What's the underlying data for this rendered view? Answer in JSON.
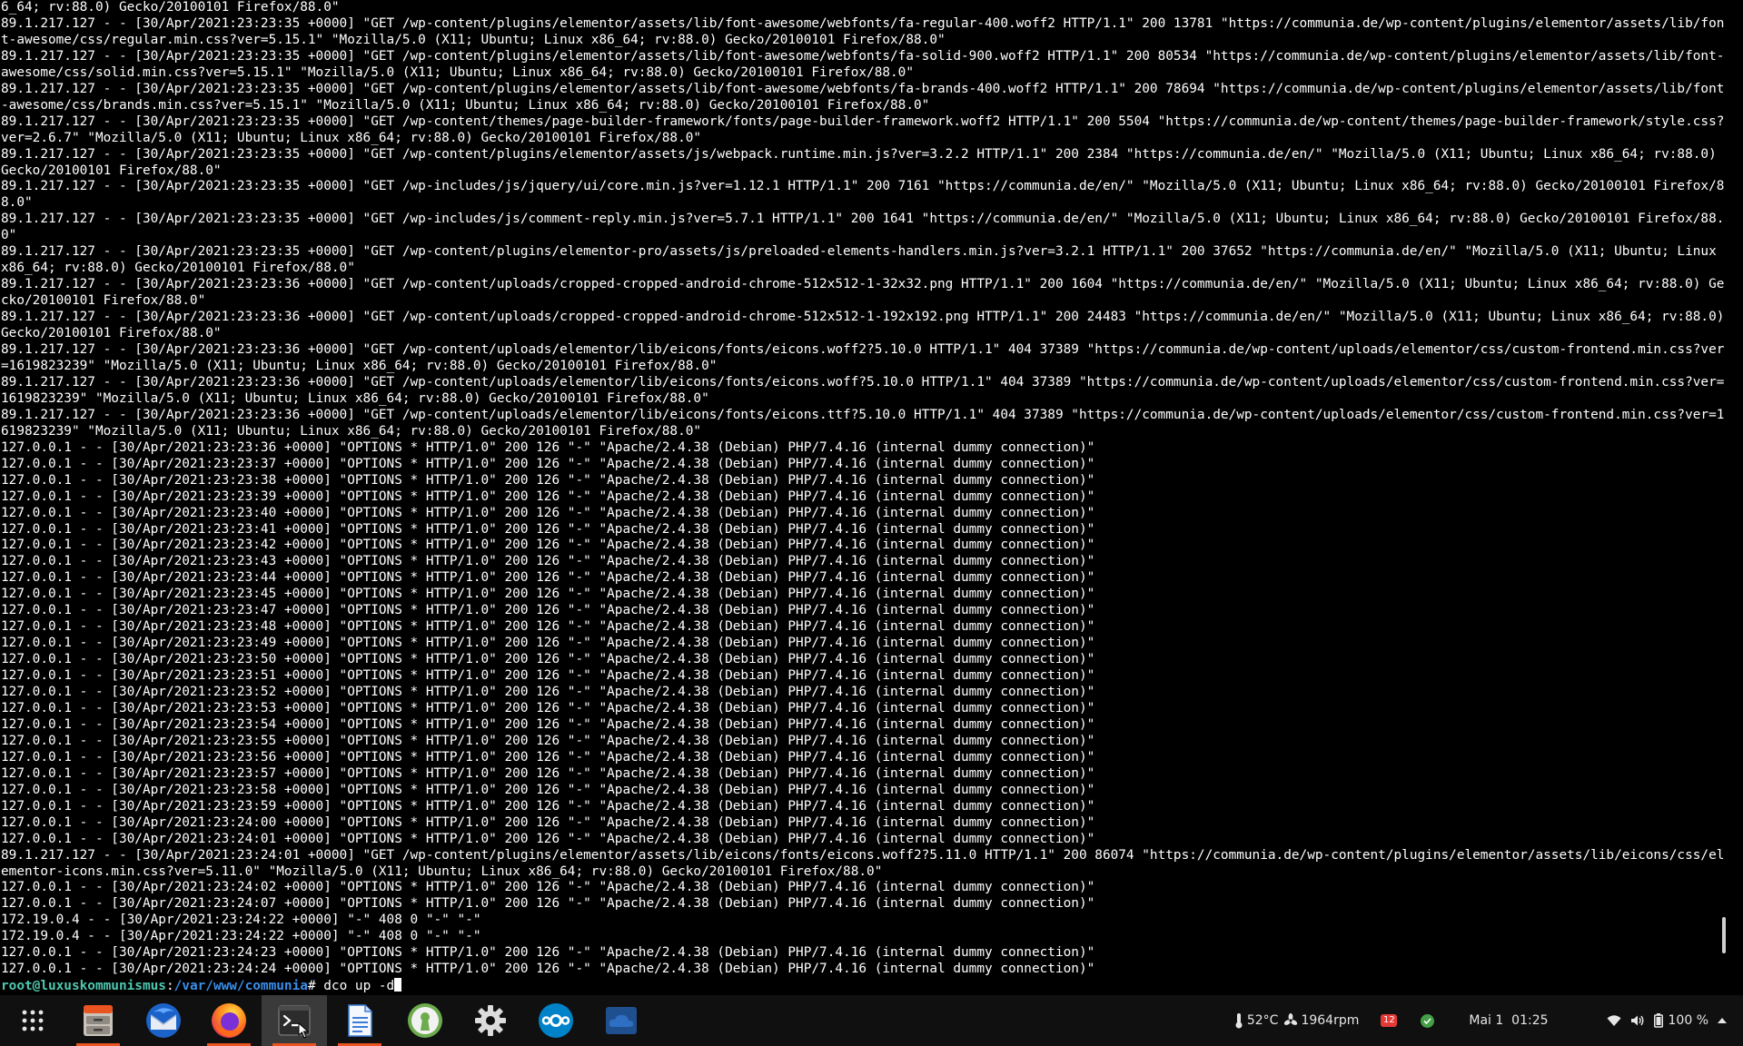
{
  "terminal": {
    "log_lines": [
      "6_64; rv:88.0) Gecko/20100101 Firefox/88.0\"",
      "89.1.217.127 - - [30/Apr/2021:23:23:35 +0000] \"GET /wp-content/plugins/elementor/assets/lib/font-awesome/webfonts/fa-regular-400.woff2 HTTP/1.1\" 200 13781 \"https://communia.de/wp-content/plugins/elementor/assets/lib/font-awesome/css/regular.min.css?ver=5.15.1\" \"Mozilla/5.0 (X11; Ubuntu; Linux x86_64; rv:88.0) Gecko/20100101 Firefox/88.0\"",
      "89.1.217.127 - - [30/Apr/2021:23:23:35 +0000] \"GET /wp-content/plugins/elementor/assets/lib/font-awesome/webfonts/fa-solid-900.woff2 HTTP/1.1\" 200 80534 \"https://communia.de/wp-content/plugins/elementor/assets/lib/font-awesome/css/solid.min.css?ver=5.15.1\" \"Mozilla/5.0 (X11; Ubuntu; Linux x86_64; rv:88.0) Gecko/20100101 Firefox/88.0\"",
      "89.1.217.127 - - [30/Apr/2021:23:23:35 +0000] \"GET /wp-content/plugins/elementor/assets/lib/font-awesome/webfonts/fa-brands-400.woff2 HTTP/1.1\" 200 78694 \"https://communia.de/wp-content/plugins/elementor/assets/lib/font-awesome/css/brands.min.css?ver=5.15.1\" \"Mozilla/5.0 (X11; Ubuntu; Linux x86_64; rv:88.0) Gecko/20100101 Firefox/88.0\"",
      "89.1.217.127 - - [30/Apr/2021:23:23:35 +0000] \"GET /wp-content/themes/page-builder-framework/fonts/page-builder-framework.woff2 HTTP/1.1\" 200 5504 \"https://communia.de/wp-content/themes/page-builder-framework/style.css?ver=2.6.7\" \"Mozilla/5.0 (X11; Ubuntu; Linux x86_64; rv:88.0) Gecko/20100101 Firefox/88.0\"",
      "89.1.217.127 - - [30/Apr/2021:23:23:35 +0000] \"GET /wp-content/plugins/elementor/assets/js/webpack.runtime.min.js?ver=3.2.2 HTTP/1.1\" 200 2384 \"https://communia.de/en/\" \"Mozilla/5.0 (X11; Ubuntu; Linux x86_64; rv:88.0) Gecko/20100101 Firefox/88.0\"",
      "89.1.217.127 - - [30/Apr/2021:23:23:35 +0000] \"GET /wp-includes/js/jquery/ui/core.min.js?ver=1.12.1 HTTP/1.1\" 200 7161 \"https://communia.de/en/\" \"Mozilla/5.0 (X11; Ubuntu; Linux x86_64; rv:88.0) Gecko/20100101 Firefox/88.0\"",
      "89.1.217.127 - - [30/Apr/2021:23:23:35 +0000] \"GET /wp-includes/js/comment-reply.min.js?ver=5.7.1 HTTP/1.1\" 200 1641 \"https://communia.de/en/\" \"Mozilla/5.0 (X11; Ubuntu; Linux x86_64; rv:88.0) Gecko/20100101 Firefox/88.0\"",
      "89.1.217.127 - - [30/Apr/2021:23:23:35 +0000] \"GET /wp-content/plugins/elementor-pro/assets/js/preloaded-elements-handlers.min.js?ver=3.2.1 HTTP/1.1\" 200 37652 \"https://communia.de/en/\" \"Mozilla/5.0 (X11; Ubuntu; Linux x86_64; rv:88.0) Gecko/20100101 Firefox/88.0\"",
      "89.1.217.127 - - [30/Apr/2021:23:23:36 +0000] \"GET /wp-content/uploads/cropped-cropped-android-chrome-512x512-1-32x32.png HTTP/1.1\" 200 1604 \"https://communia.de/en/\" \"Mozilla/5.0 (X11; Ubuntu; Linux x86_64; rv:88.0) Gecko/20100101 Firefox/88.0\"",
      "89.1.217.127 - - [30/Apr/2021:23:23:36 +0000] \"GET /wp-content/uploads/cropped-cropped-android-chrome-512x512-1-192x192.png HTTP/1.1\" 200 24483 \"https://communia.de/en/\" \"Mozilla/5.0 (X11; Ubuntu; Linux x86_64; rv:88.0) Gecko/20100101 Firefox/88.0\"",
      "89.1.217.127 - - [30/Apr/2021:23:23:36 +0000] \"GET /wp-content/uploads/elementor/lib/eicons/fonts/eicons.woff2?5.10.0 HTTP/1.1\" 404 37389 \"https://communia.de/wp-content/uploads/elementor/css/custom-frontend.min.css?ver=1619823239\" \"Mozilla/5.0 (X11; Ubuntu; Linux x86_64; rv:88.0) Gecko/20100101 Firefox/88.0\"",
      "89.1.217.127 - - [30/Apr/2021:23:23:36 +0000] \"GET /wp-content/uploads/elementor/lib/eicons/fonts/eicons.woff?5.10.0 HTTP/1.1\" 404 37389 \"https://communia.de/wp-content/uploads/elementor/css/custom-frontend.min.css?ver=1619823239\" \"Mozilla/5.0 (X11; Ubuntu; Linux x86_64; rv:88.0) Gecko/20100101 Firefox/88.0\"",
      "89.1.217.127 - - [30/Apr/2021:23:23:36 +0000] \"GET /wp-content/uploads/elementor/lib/eicons/fonts/eicons.ttf?5.10.0 HTTP/1.1\" 404 37389 \"https://communia.de/wp-content/uploads/elementor/css/custom-frontend.min.css?ver=1619823239\" \"Mozilla/5.0 (X11; Ubuntu; Linux x86_64; rv:88.0) Gecko/20100101 Firefox/88.0\"",
      "127.0.0.1 - - [30/Apr/2021:23:23:36 +0000] \"OPTIONS * HTTP/1.0\" 200 126 \"-\" \"Apache/2.4.38 (Debian) PHP/7.4.16 (internal dummy connection)\"",
      "127.0.0.1 - - [30/Apr/2021:23:23:37 +0000] \"OPTIONS * HTTP/1.0\" 200 126 \"-\" \"Apache/2.4.38 (Debian) PHP/7.4.16 (internal dummy connection)\"",
      "127.0.0.1 - - [30/Apr/2021:23:23:38 +0000] \"OPTIONS * HTTP/1.0\" 200 126 \"-\" \"Apache/2.4.38 (Debian) PHP/7.4.16 (internal dummy connection)\"",
      "127.0.0.1 - - [30/Apr/2021:23:23:39 +0000] \"OPTIONS * HTTP/1.0\" 200 126 \"-\" \"Apache/2.4.38 (Debian) PHP/7.4.16 (internal dummy connection)\"",
      "127.0.0.1 - - [30/Apr/2021:23:23:40 +0000] \"OPTIONS * HTTP/1.0\" 200 126 \"-\" \"Apache/2.4.38 (Debian) PHP/7.4.16 (internal dummy connection)\"",
      "127.0.0.1 - - [30/Apr/2021:23:23:41 +0000] \"OPTIONS * HTTP/1.0\" 200 126 \"-\" \"Apache/2.4.38 (Debian) PHP/7.4.16 (internal dummy connection)\"",
      "127.0.0.1 - - [30/Apr/2021:23:23:42 +0000] \"OPTIONS * HTTP/1.0\" 200 126 \"-\" \"Apache/2.4.38 (Debian) PHP/7.4.16 (internal dummy connection)\"",
      "127.0.0.1 - - [30/Apr/2021:23:23:43 +0000] \"OPTIONS * HTTP/1.0\" 200 126 \"-\" \"Apache/2.4.38 (Debian) PHP/7.4.16 (internal dummy connection)\"",
      "127.0.0.1 - - [30/Apr/2021:23:23:44 +0000] \"OPTIONS * HTTP/1.0\" 200 126 \"-\" \"Apache/2.4.38 (Debian) PHP/7.4.16 (internal dummy connection)\"",
      "127.0.0.1 - - [30/Apr/2021:23:23:45 +0000] \"OPTIONS * HTTP/1.0\" 200 126 \"-\" \"Apache/2.4.38 (Debian) PHP/7.4.16 (internal dummy connection)\"",
      "127.0.0.1 - - [30/Apr/2021:23:23:47 +0000] \"OPTIONS * HTTP/1.0\" 200 126 \"-\" \"Apache/2.4.38 (Debian) PHP/7.4.16 (internal dummy connection)\"",
      "127.0.0.1 - - [30/Apr/2021:23:23:48 +0000] \"OPTIONS * HTTP/1.0\" 200 126 \"-\" \"Apache/2.4.38 (Debian) PHP/7.4.16 (internal dummy connection)\"",
      "127.0.0.1 - - [30/Apr/2021:23:23:49 +0000] \"OPTIONS * HTTP/1.0\" 200 126 \"-\" \"Apache/2.4.38 (Debian) PHP/7.4.16 (internal dummy connection)\"",
      "127.0.0.1 - - [30/Apr/2021:23:23:50 +0000] \"OPTIONS * HTTP/1.0\" 200 126 \"-\" \"Apache/2.4.38 (Debian) PHP/7.4.16 (internal dummy connection)\"",
      "127.0.0.1 - - [30/Apr/2021:23:23:51 +0000] \"OPTIONS * HTTP/1.0\" 200 126 \"-\" \"Apache/2.4.38 (Debian) PHP/7.4.16 (internal dummy connection)\"",
      "127.0.0.1 - - [30/Apr/2021:23:23:52 +0000] \"OPTIONS * HTTP/1.0\" 200 126 \"-\" \"Apache/2.4.38 (Debian) PHP/7.4.16 (internal dummy connection)\"",
      "127.0.0.1 - - [30/Apr/2021:23:23:53 +0000] \"OPTIONS * HTTP/1.0\" 200 126 \"-\" \"Apache/2.4.38 (Debian) PHP/7.4.16 (internal dummy connection)\"",
      "127.0.0.1 - - [30/Apr/2021:23:23:54 +0000] \"OPTIONS * HTTP/1.0\" 200 126 \"-\" \"Apache/2.4.38 (Debian) PHP/7.4.16 (internal dummy connection)\"",
      "127.0.0.1 - - [30/Apr/2021:23:23:55 +0000] \"OPTIONS * HTTP/1.0\" 200 126 \"-\" \"Apache/2.4.38 (Debian) PHP/7.4.16 (internal dummy connection)\"",
      "127.0.0.1 - - [30/Apr/2021:23:23:56 +0000] \"OPTIONS * HTTP/1.0\" 200 126 \"-\" \"Apache/2.4.38 (Debian) PHP/7.4.16 (internal dummy connection)\"",
      "127.0.0.1 - - [30/Apr/2021:23:23:57 +0000] \"OPTIONS * HTTP/1.0\" 200 126 \"-\" \"Apache/2.4.38 (Debian) PHP/7.4.16 (internal dummy connection)\"",
      "127.0.0.1 - - [30/Apr/2021:23:23:58 +0000] \"OPTIONS * HTTP/1.0\" 200 126 \"-\" \"Apache/2.4.38 (Debian) PHP/7.4.16 (internal dummy connection)\"",
      "127.0.0.1 - - [30/Apr/2021:23:23:59 +0000] \"OPTIONS * HTTP/1.0\" 200 126 \"-\" \"Apache/2.4.38 (Debian) PHP/7.4.16 (internal dummy connection)\"",
      "127.0.0.1 - - [30/Apr/2021:23:24:00 +0000] \"OPTIONS * HTTP/1.0\" 200 126 \"-\" \"Apache/2.4.38 (Debian) PHP/7.4.16 (internal dummy connection)\"",
      "127.0.0.1 - - [30/Apr/2021:23:24:01 +0000] \"OPTIONS * HTTP/1.0\" 200 126 \"-\" \"Apache/2.4.38 (Debian) PHP/7.4.16 (internal dummy connection)\"",
      "89.1.217.127 - - [30/Apr/2021:23:24:01 +0000] \"GET /wp-content/plugins/elementor/assets/lib/eicons/fonts/eicons.woff2?5.11.0 HTTP/1.1\" 200 86074 \"https://communia.de/wp-content/plugins/elementor/assets/lib/eicons/css/elementor-icons.min.css?ver=5.11.0\" \"Mozilla/5.0 (X11; Ubuntu; Linux x86_64; rv:88.0) Gecko/20100101 Firefox/88.0\"",
      "127.0.0.1 - - [30/Apr/2021:23:24:02 +0000] \"OPTIONS * HTTP/1.0\" 200 126 \"-\" \"Apache/2.4.38 (Debian) PHP/7.4.16 (internal dummy connection)\"",
      "127.0.0.1 - - [30/Apr/2021:23:24:07 +0000] \"OPTIONS * HTTP/1.0\" 200 126 \"-\" \"Apache/2.4.38 (Debian) PHP/7.4.16 (internal dummy connection)\"",
      "172.19.0.4 - - [30/Apr/2021:23:24:22 +0000] \"-\" 408 0 \"-\" \"-\"",
      "172.19.0.4 - - [30/Apr/2021:23:24:22 +0000] \"-\" 408 0 \"-\" \"-\"",
      "127.0.0.1 - - [30/Apr/2021:23:24:23 +0000] \"OPTIONS * HTTP/1.0\" 200 126 \"-\" \"Apache/2.4.38 (Debian) PHP/7.4.16 (internal dummy connection)\"",
      "127.0.0.1 - - [30/Apr/2021:23:24:24 +0000] \"OPTIONS * HTTP/1.0\" 200 126 \"-\" \"Apache/2.4.38 (Debian) PHP/7.4.16 (internal dummy connection)\""
    ],
    "prompt": {
      "user_host": "root@luxuskommunismus",
      "separator": ":",
      "path": "/var/www/communia",
      "symbol": "# ",
      "command": "dco up -d"
    }
  },
  "dock": {
    "items": [
      {
        "name": "app-grid-button",
        "icon": "app-grid-icon"
      },
      {
        "name": "files-app",
        "icon": "file-cabinet-icon"
      },
      {
        "name": "thunderbird-app",
        "icon": "mail-bird-icon"
      },
      {
        "name": "firefox-app",
        "icon": "firefox-icon"
      },
      {
        "name": "terminal-app",
        "icon": "terminal-icon"
      },
      {
        "name": "libreoffice-writer-app",
        "icon": "document-icon"
      },
      {
        "name": "keepassxc-app",
        "icon": "keyhole-icon"
      },
      {
        "name": "settings-app",
        "icon": "gear-icon"
      },
      {
        "name": "nextcloud-app",
        "icon": "nextcloud-icon"
      },
      {
        "name": "cloud-storage-app",
        "icon": "cloud-icon"
      }
    ],
    "active_item": "terminal-app"
  },
  "tray": {
    "temperature": "52°C",
    "fan": "1964rpm",
    "notification_count": "12",
    "datetime": "Mai 1  01:25",
    "battery": "100 %"
  },
  "colors": {
    "terminal_bg": "#000000",
    "terminal_fg": "#ffffff",
    "prompt_user": "#4ec9b0",
    "prompt_path": "#3b8eea",
    "accent": "#e95420",
    "taskbar_bg": "#101010"
  }
}
